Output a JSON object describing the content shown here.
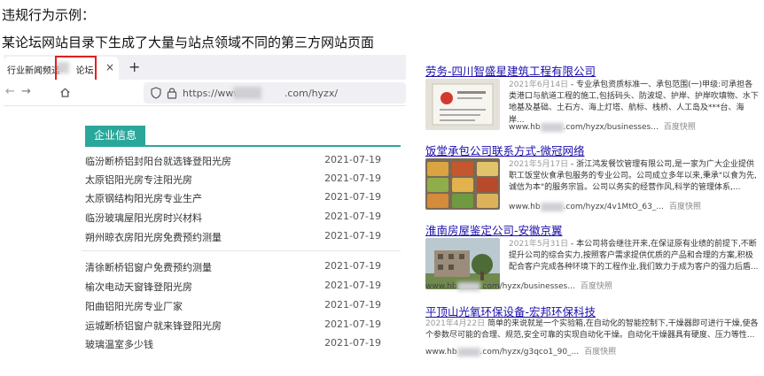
{
  "heading": {
    "line1": "违规行为示例：",
    "line2": "某论坛网站目录下生成了大量与站点领域不同的第三方网站页面"
  },
  "browser": {
    "tab_title": "行业新闻频道-",
    "tab_title_end": "论坛",
    "close_glyph": "×",
    "new_tab_glyph": "+",
    "back_glyph": "←",
    "forward_glyph": "→",
    "url_prefix": "https://www.hb",
    "url_suffix": ".com/hyzx/",
    "icons": [
      "shield-icon",
      "lock-icon",
      "home-icon",
      "close-icon",
      "plus-icon"
    ]
  },
  "section": {
    "title": "企业信息",
    "accent_color": "#2aa79b",
    "rows": [
      {
        "title": "临汾断桥铝封阳台就选锋登阳光房",
        "date": "2021-07-19"
      },
      {
        "title": "太原铝阳光房专注阳光房",
        "date": "2021-07-19"
      },
      {
        "title": "太原钢结构阳光房专业生产",
        "date": "2021-07-19"
      },
      {
        "title": "临汾玻璃屋阳光房时兴材料",
        "date": "2021-07-19"
      },
      {
        "title": "朔州晾衣房阳光房免费预约测量",
        "date": "2021-07-19"
      },
      {
        "title": "清徐断桥铝窗户免费预约测量",
        "date": "2021-07-19"
      },
      {
        "title": "榆次电动天窗锋登阳光房",
        "date": "2021-07-19"
      },
      {
        "title": "阳曲铝阳光房专业厂家",
        "date": "2021-07-19"
      },
      {
        "title": "运城断桥铝窗户就来锋登阳光房",
        "date": "2021-07-19"
      },
      {
        "title": "玻璃温室多少钱",
        "date": "2021-07-19"
      }
    ]
  },
  "results": [
    {
      "title": "劳务-四川智盛星建筑工程有限公司",
      "date": "2021年6月14日",
      "snippet": "专业承包资质标准一、承包范围(一)甲级:可承担各类港口与航道工程的施工,包括码头、防波堤、护岸、护岸吹填物、水下地基及基础、土石方、海上灯塔、航标、栈桥、人工岛及***台、海岸...",
      "url_prefix": "www.hb",
      "url_suffix": ".com/hyzx/businesses...",
      "cache": "百度快照",
      "thumb": "certificate"
    },
    {
      "title": "饭堂承包公司联系方式-微冠网络",
      "date": "2021年5月17日",
      "snippet": "浙江鸿发餐饮管理有限公司,是一家为广大企业提供职工饭堂伙食承包服务的专业公司。公司成立多年以来,秉承\"以食为先,诚信为本\"的服务宗旨。公司以务实的经营作风,科学的管理体系,...",
      "url_prefix": "www.hb",
      "url_suffix": ".com/hyzx/4v1MtO_63_...",
      "cache": "百度快照",
      "thumb": "food"
    },
    {
      "title": "淮南房屋鉴定公司-安徽京翼",
      "date": "2021年5月31日",
      "snippet": "本公司将会继往开来,在保证原有业绩的前提下,不断提升公司的综合实力,按照客户需求提供优质的产品和合理的方案,积极配合客户完成各种环境下的工程作业,我们致力于成为客户的强力后盾...",
      "url_prefix": "www.hb",
      "url_suffix": ".com/hyzx/businesses...",
      "cache": "百度快照",
      "thumb": "building"
    },
    {
      "title": "平顶山光氧环保设备-宏邦环保科技",
      "date": "2021年4月22日",
      "snippet": "简单的来说就是一个实验箱,在自动化的智能控制下,干燥器即可进行干燥,使各个参数尽可能的合理、规范,安全可靠的实现自动化干燥。自动化干燥器具有硬度、压力等性...",
      "url_prefix": "www.hb",
      "url_suffix": ".com/hyzx/g3qco1_90_...",
      "cache": "百度快照",
      "thumb": "none"
    }
  ]
}
